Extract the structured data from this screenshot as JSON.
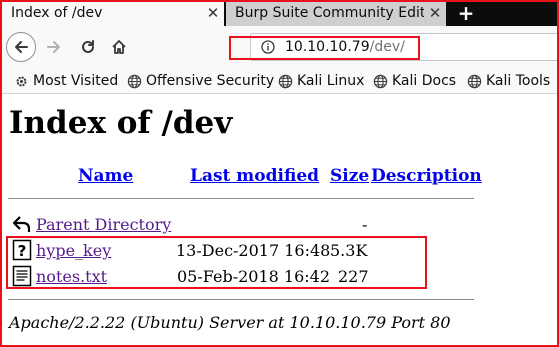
{
  "tabs": [
    {
      "title": "Index of /dev",
      "active": true
    },
    {
      "title": "Burp Suite Community Edition",
      "active": false
    }
  ],
  "toolbar": {
    "url_host": "10.10.10.79",
    "url_path": "/dev/"
  },
  "bookmarks": [
    {
      "label": "Most Visited",
      "icon": "gear-icon"
    },
    {
      "label": "Offensive Security",
      "icon": "globe-icon"
    },
    {
      "label": "Kali Linux",
      "icon": "globe-icon"
    },
    {
      "label": "Kali Docs",
      "icon": "globe-icon"
    },
    {
      "label": "Kali Tools",
      "icon": "globe-icon"
    }
  ],
  "page": {
    "title": "Index of /dev",
    "columns": {
      "name": "Name",
      "last_modified": "Last modified",
      "size": "Size",
      "description": "Description"
    },
    "parent": {
      "name": "Parent Directory",
      "size": "-",
      "icon": "back-folder-icon"
    },
    "files": [
      {
        "name": "hype_key",
        "modified": "13-Dec-2017 16:48",
        "size": "5.3K",
        "icon": "unknown-file-icon"
      },
      {
        "name": "notes.txt",
        "modified": "05-Feb-2018 16:42",
        "size": "227",
        "icon": "text-file-icon"
      }
    ],
    "address": "Apache/2.2.22 (Ubuntu) Server at 10.10.10.79 Port 80"
  },
  "colors": {
    "annotation": "#e8131a",
    "link_visited": "#551a8b",
    "link": "#0000ee",
    "tab_strip": "#0c0c0d"
  }
}
